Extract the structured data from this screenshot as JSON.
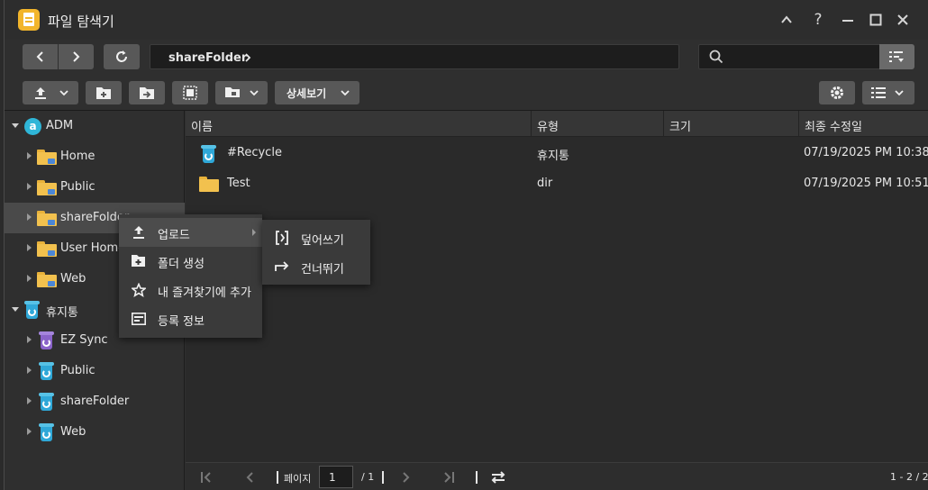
{
  "window": {
    "title": "파일 탐색기"
  },
  "address": {
    "path": "shareFolder"
  },
  "search": {
    "placeholder": ""
  },
  "toolbar": {
    "view_mode_label": "상세보기"
  },
  "sidebar": {
    "root_label": "ADM",
    "adm_items": [
      "Home",
      "Public",
      "shareFolder",
      "User Home",
      "Web"
    ],
    "recycle_root_label": "휴지통",
    "recycle_items": [
      "EZ Sync",
      "Public",
      "shareFolder",
      "Web"
    ]
  },
  "table": {
    "headers": {
      "name": "이름",
      "type": "유형",
      "size": "크기",
      "modified": "최종 수정일"
    },
    "rows": [
      {
        "name": "#Recycle",
        "type": "휴지통",
        "size": "",
        "modified": "07/19/2025 PM 10:38"
      },
      {
        "name": "Test",
        "type": "dir",
        "size": "",
        "modified": "07/19/2025 PM 10:51"
      }
    ]
  },
  "context_menu": {
    "items": [
      {
        "label": "업로드",
        "icon": "upload-icon"
      },
      {
        "label": "폴더 생성",
        "icon": "new-folder-icon"
      },
      {
        "label": "내 즐겨찾기에 추가",
        "icon": "star-icon"
      },
      {
        "label": "등록 정보",
        "icon": "properties-icon"
      }
    ],
    "submenu": [
      {
        "label": "덮어쓰기",
        "icon": "overwrite-icon"
      },
      {
        "label": "건너뛰기",
        "icon": "skip-icon"
      }
    ]
  },
  "pagination": {
    "page_label": "페이지",
    "current_page": "1",
    "total": "/ 1",
    "range": "1 - 2 / 2"
  },
  "colors": {
    "accent_folder": "#f2c14e",
    "app_icon": "#f2b52b",
    "recycle_blue": "#2fa8d8",
    "recycle_purple": "#8a63c9"
  }
}
